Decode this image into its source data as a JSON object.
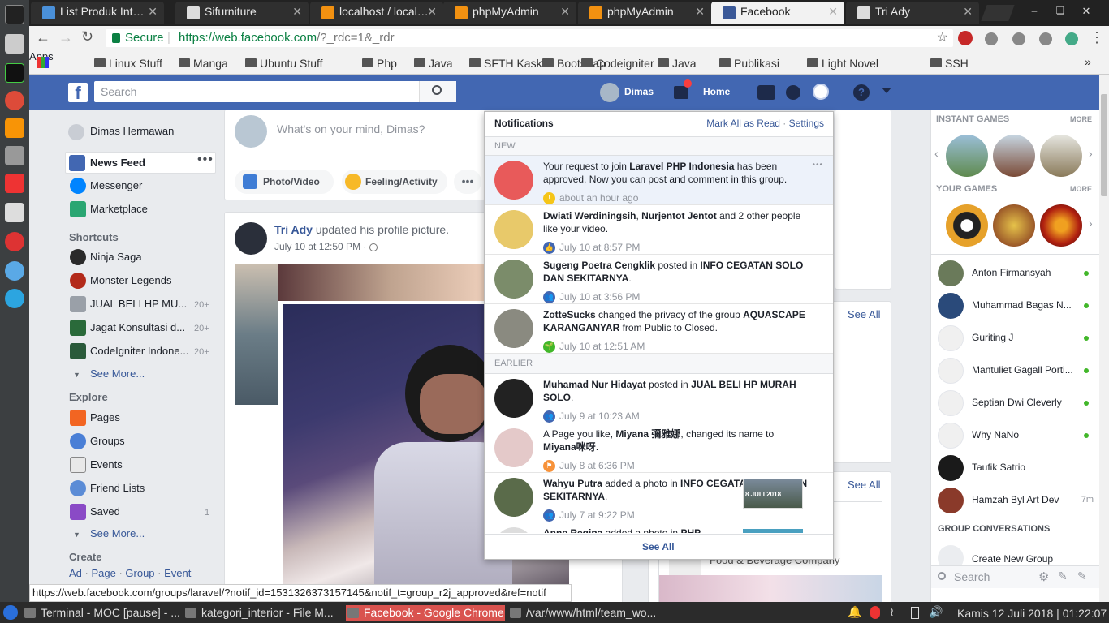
{
  "browser": {
    "tabs": [
      {
        "label": "List Produk Interio",
        "active": false,
        "color": "#4a90d9"
      },
      {
        "label": "Sifurniture",
        "active": false,
        "color": "#ddd"
      },
      {
        "label": "localhost / localho",
        "active": false,
        "color": "#f29111"
      },
      {
        "label": "phpMyAdmin",
        "active": false,
        "color": "#f29111"
      },
      {
        "label": "phpMyAdmin",
        "active": false,
        "color": "#f29111"
      },
      {
        "label": "Facebook",
        "active": true,
        "color": "#3b5998"
      },
      {
        "label": "Tri Ady",
        "active": false,
        "color": "#ddd"
      }
    ],
    "secure_label": "Secure",
    "url": "https://web.facebook.com/?_rdc=1&_rdr",
    "url_host": "https://web.facebook.com",
    "url_path": "/?_rdc=1&_rdr",
    "bookmarks": [
      "Apps",
      "Linux Stuff",
      "Manga",
      "Ubuntu Stuff",
      "Php",
      "Java",
      "SFTH Kaskus",
      "Bootstrap",
      "Codeigniter",
      "Java",
      "Publikasi",
      "Light Novel",
      "SSH"
    ],
    "status_url": "https://web.facebook.com/groups/laravel/?notif_id=1531326373157145&notif_t=group_r2j_approved&ref=notif"
  },
  "fb": {
    "search_placeholder": "Search",
    "user_name": "Dimas",
    "home": "Home",
    "left": {
      "profile": "Dimas Hermawan",
      "news_feed": "News Feed",
      "messenger": "Messenger",
      "marketplace": "Marketplace",
      "shortcuts_title": "Shortcuts",
      "shortcuts": [
        {
          "label": "Ninja Saga",
          "count": ""
        },
        {
          "label": "Monster Legends",
          "count": ""
        },
        {
          "label": "JUAL BELI HP MU...",
          "count": "20+"
        },
        {
          "label": "Jagat Konsultasi d...",
          "count": "20+"
        },
        {
          "label": "CodeIgniter Indone...",
          "count": "20+"
        }
      ],
      "see_more": "See More...",
      "explore_title": "Explore",
      "explore": [
        {
          "label": "Pages",
          "count": ""
        },
        {
          "label": "Groups",
          "count": ""
        },
        {
          "label": "Events",
          "count": ""
        },
        {
          "label": "Friend Lists",
          "count": ""
        },
        {
          "label": "Saved",
          "count": "1"
        }
      ],
      "see_more2": "See More...",
      "create_title": "Create",
      "create_links": [
        "Ad",
        "Page",
        "Group",
        "Event"
      ]
    },
    "composer": {
      "placeholder": "What's on your mind, Dimas?",
      "photo": "Photo/Video",
      "feeling": "Feeling/Activity"
    },
    "post": {
      "author": "Tri Ady",
      "action": "updated his profile picture.",
      "time": "July 10 at 12:50 PM · "
    },
    "see_all_1": "See All",
    "see_all_2": "See All",
    "bg_text": "Food & Beverage Company",
    "notifications": {
      "title": "Notifications",
      "mark_all": "Mark All as Read",
      "sep": " · ",
      "settings": "Settings",
      "new_label": "NEW",
      "earlier_label": "EARLIER",
      "see_all": "See All",
      "new_items": [
        {
          "pre": "Your request to join ",
          "b1": "Laravel PHP Indonesia",
          "mid": " has been approved. Now you can post and comment in this group.",
          "b2": "",
          "post": "",
          "time": "about an hour ago",
          "avatar_color": "#e85a5a",
          "icon_color": "#f5c518",
          "icon": "!"
        },
        {
          "pre": "",
          "b1": "Dwiati Werdiningsih",
          "mid": ", ",
          "b2": "Nurjentot Jentot",
          "post": " and 2 other people like your video.",
          "time": "July 10 at 8:57 PM",
          "avatar_color": "#e8c96a",
          "icon_color": "#4267b2",
          "icon": "👍"
        },
        {
          "pre": "",
          "b1": "Sugeng Poetra Cengklik",
          "mid": " posted in ",
          "b2": "INFO CEGATAN SOLO DAN SEKITARNYA",
          "post": ".",
          "time": "July 10 at 3:56 PM",
          "avatar_color": "#7b8c6a",
          "icon_color": "#4267b2",
          "icon": "👥"
        },
        {
          "pre": "",
          "b1": "ZotteSucks",
          "mid": " changed the privacy of the group ",
          "b2": "AQUASCAPE KARANGANYAR",
          "post": " from Public to Closed.",
          "time": "July 10 at 12:51 AM",
          "avatar_color": "#8a8a80",
          "icon_color": "#42b72a",
          "icon": "🌱"
        }
      ],
      "earlier_items": [
        {
          "pre": "",
          "b1": "Muhamad Nur Hidayat",
          "mid": " posted in ",
          "b2": "JUAL BELI HP MURAH SOLO",
          "post": ".",
          "time": "July 9 at 10:23 AM",
          "avatar_color": "#222",
          "icon_color": "#4267b2",
          "icon": "👥"
        },
        {
          "pre": "A Page you like, ",
          "b1": "Miyana 彌雅娜",
          "mid": ", changed its name to ",
          "b2": "Miyana咪呀",
          "post": ".",
          "time": "July 8 at 6:36 PM",
          "avatar_color": "#e4c9c9",
          "icon_color": "#f7923a",
          "icon": "⚑"
        },
        {
          "pre": "",
          "b1": "Wahyu Putra",
          "mid": " added a photo in ",
          "b2": "INFO CEGATAN SOLO DAN SEKITARNYA",
          "post": ".",
          "time": "July 7 at 9:22 PM",
          "avatar_color": "#5a6b4a",
          "icon_color": "#4267b2",
          "icon": "👥"
        },
        {
          "pre": "",
          "b1": "Anne Regina",
          "mid": " added a photo in ",
          "b2": "PHP",
          "post": "",
          "time": "",
          "avatar_color": "#ddd",
          "icon_color": "#4267b2",
          "icon": ""
        }
      ],
      "thumb_text": "8 JULI 2018"
    },
    "right": {
      "instant_games": "INSTANT GAMES",
      "more": "MORE",
      "your_games": "YOUR GAMES",
      "more2": "MORE",
      "friends": [
        {
          "name": "Anton Firmansyah",
          "online": true,
          "extra": ""
        },
        {
          "name": "Muhammad Bagas N...",
          "online": true,
          "extra": ""
        },
        {
          "name": "Guriting J",
          "online": true,
          "extra": ""
        },
        {
          "name": "Mantuliet Gagall Porti...",
          "online": true,
          "extra": ""
        },
        {
          "name": "Septian Dwi Cleverly",
          "online": true,
          "extra": ""
        },
        {
          "name": "Why NaNo",
          "online": true,
          "extra": ""
        },
        {
          "name": "Taufik Satrio",
          "online": false,
          "extra": ""
        },
        {
          "name": "Hamzah Byl Art Dev",
          "online": false,
          "extra": "7m"
        }
      ],
      "group_conversations": "GROUP CONVERSATIONS",
      "create_group": "Create New Group",
      "search_placeholder": "Search"
    }
  },
  "taskbar": {
    "items": [
      "Terminal - MOC [pause] - ...",
      "kategori_interior - File M...",
      "Facebook - Google Chrome",
      "/var/www/html/team_wo..."
    ],
    "clock": "Kamis 12 Juli 2018 | 01:22:07"
  }
}
